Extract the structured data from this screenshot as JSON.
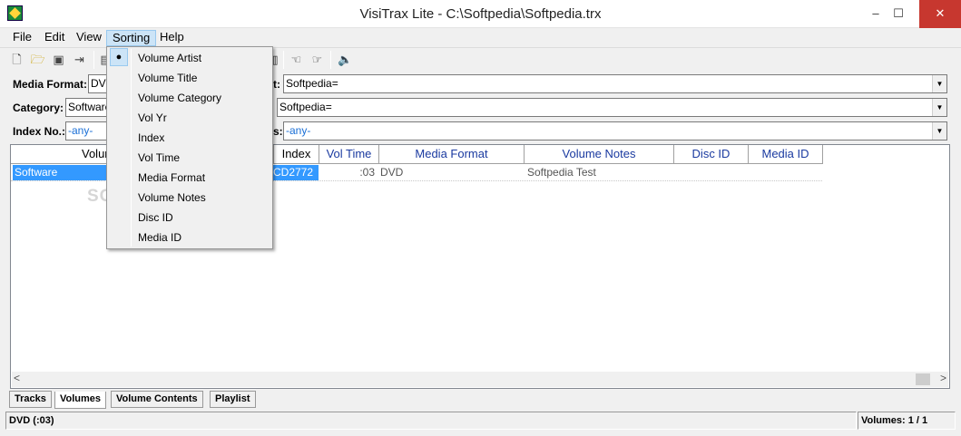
{
  "window": {
    "title": "VisiTrax Lite - C:\\Softpedia\\Softpedia.trx",
    "minimize": "–",
    "maximize": "☐",
    "close": "✕"
  },
  "menubar": [
    "File",
    "Edit",
    "View",
    "Sorting",
    "Help"
  ],
  "toolbar": {
    "icons": [
      "new-file-icon",
      "open-folder-icon",
      "save-icon",
      "export-icon",
      "print-icon",
      "document-icon",
      "hand-left-icon",
      "hand-right-icon",
      "speaker-icon"
    ]
  },
  "fields": {
    "media_format_label": "Media Format:",
    "media_format_value": "DVD",
    "artist_label_fragment": "t:",
    "artist_value": "Softpedia=",
    "category_label": "Category:",
    "category_value": "Software",
    "category2_value": "Softpedia=",
    "index_label": "Index No.:",
    "index_value": "-any-",
    "notes_label_fragment": "s:",
    "notes_value": "-any-"
  },
  "table": {
    "columns": [
      "Volum",
      "Index",
      "Vol Time",
      "Media Format",
      "Volume Notes",
      "Disc ID",
      "Media ID"
    ],
    "rows": [
      {
        "volume": "Software",
        "index": "CD2772",
        "vol_time": ":03",
        "media_format": "DVD",
        "volume_notes": "Softpedia Test",
        "disc_id": "",
        "media_id": ""
      }
    ],
    "scroll_left": "<",
    "scroll_right": ">"
  },
  "tabs": [
    "Tracks",
    "Volumes",
    "Volume Contents",
    "Playlist"
  ],
  "active_tab": "Volumes",
  "status": {
    "left": "DVD (:03)",
    "right": "Volumes: 1 / 1"
  },
  "sorting_menu": {
    "checked_item": "Volume Artist",
    "check_glyph": "●",
    "items": [
      "Volume Artist",
      "Volume Title",
      "Volume Category",
      "Vol Yr",
      "Index",
      "Vol Time",
      "Media Format",
      "Volume Notes",
      "Disc ID",
      "Media ID"
    ]
  },
  "watermark": "SOFTPEDIA"
}
